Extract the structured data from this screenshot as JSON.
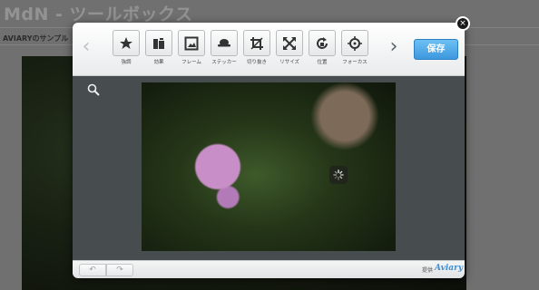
{
  "page": {
    "title": "MdN - ツールボックス",
    "subtitle": "AVIARYのサンプル"
  },
  "editor": {
    "tools": [
      {
        "label": "強調",
        "icon": "enhance-icon"
      },
      {
        "label": "効果",
        "icon": "effects-icon"
      },
      {
        "label": "フレーム",
        "icon": "frame-icon"
      },
      {
        "label": "ステッカー",
        "icon": "sticker-icon"
      },
      {
        "label": "切り抜き",
        "icon": "crop-icon"
      },
      {
        "label": "リサイズ",
        "icon": "resize-icon"
      },
      {
        "label": "位置",
        "icon": "orientation-icon"
      },
      {
        "label": "フォーカス",
        "icon": "focus-icon"
      }
    ],
    "save_label": "保存",
    "close_label": "×",
    "undo_label": "↶",
    "redo_label": "↷",
    "powered_by": "提供",
    "brand": "Aviary",
    "page_dots": 3,
    "active_dot": 0,
    "accent_color": "#3d98dd"
  }
}
